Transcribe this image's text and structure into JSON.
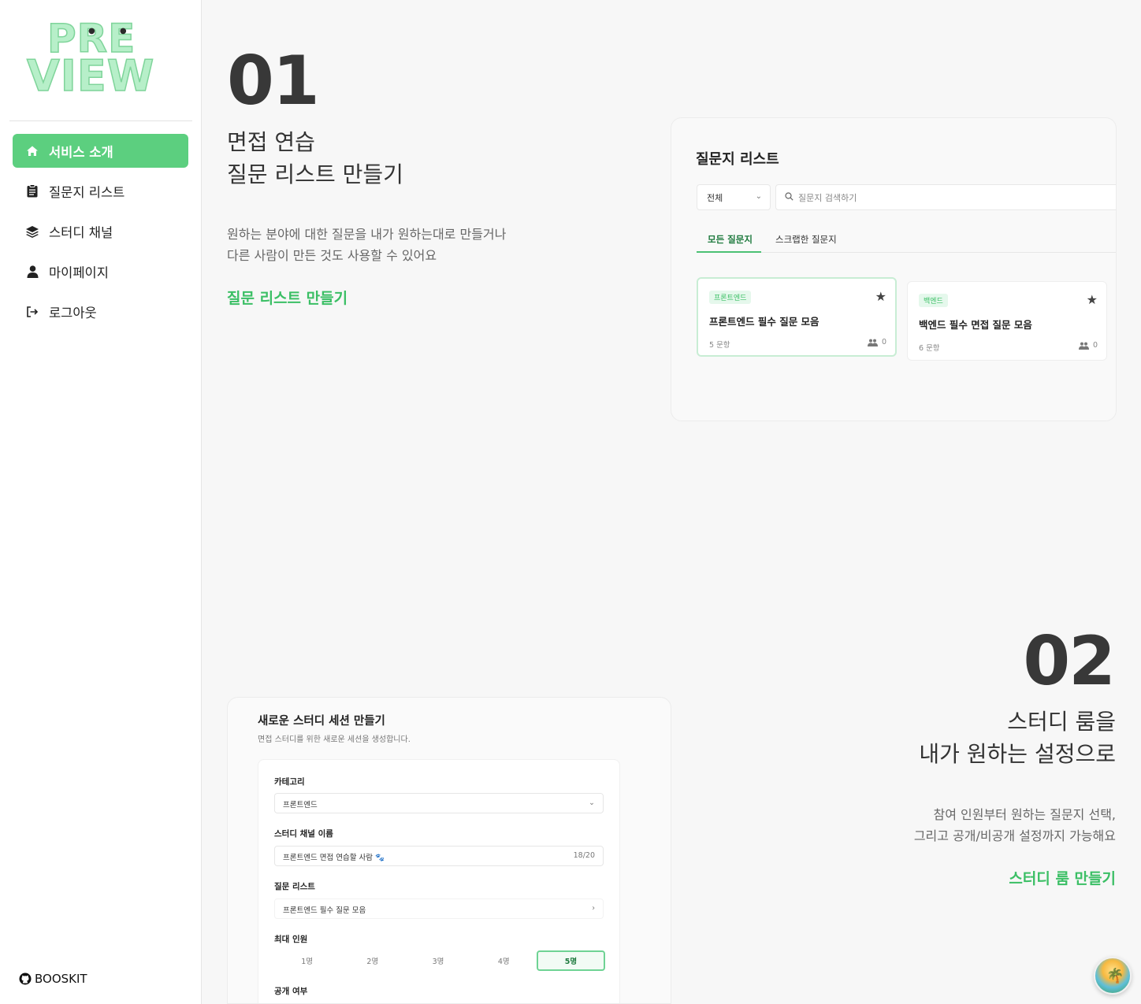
{
  "sidebar": {
    "logo": "PREVIEW",
    "items": [
      {
        "label": "서비스 소개",
        "icon": "home-icon",
        "active": true
      },
      {
        "label": "질문지 리스트",
        "icon": "clipboard-icon",
        "active": false
      },
      {
        "label": "스터디 채널",
        "icon": "layers-icon",
        "active": false
      },
      {
        "label": "마이페이지",
        "icon": "user-icon",
        "active": false
      },
      {
        "label": "로그아웃",
        "icon": "logout-icon",
        "active": false
      }
    ],
    "brand": "BOOSKIT",
    "accent": "#5ccf7f"
  },
  "section1": {
    "number": "01",
    "headline_line1": "면접 연습",
    "headline_line2": "질문 리스트 만들기",
    "desc_line1": "원하는 분야에 대한 질문을 내가 원하는대로 만들거나",
    "desc_line2": "다른 사람이 만든 것도 사용할 수 있어요",
    "cta": "질문 리스트 만들기"
  },
  "preview1": {
    "title": "질문지 리스트",
    "select_value": "전체",
    "search_placeholder": "질문지 검색하기",
    "tabs": [
      "모든 질문지",
      "스크랩한 질문지"
    ],
    "cards": [
      {
        "badge": "프론트엔드",
        "title": "프론트엔드 필수 질문 모음",
        "count": "5 문항",
        "users": "0"
      },
      {
        "badge": "백엔드",
        "title": "백엔드 필수 면접 질문 모음",
        "count": "6 문항",
        "users": "0"
      }
    ]
  },
  "section2": {
    "number": "02",
    "headline_line1": "스터디 룸을",
    "headline_line2": "내가 원하는 설정으로",
    "desc_line1": "참여 인원부터 원하는 질문지 선택,",
    "desc_line2": "그리고 공개/비공개 설정까지 가능해요",
    "cta": "스터디 룸 만들기"
  },
  "preview2": {
    "title": "새로운 스터디 세션 만들기",
    "subtitle": "면접 스터디를 위한 새로운 세션을 생성합니다.",
    "category_label": "카테고리",
    "category_value": "프론트엔드",
    "channel_label": "스터디 채널 이름",
    "channel_value": "프론트엔드 면접 연습할 사람 🐾",
    "channel_counter": "18/20",
    "list_label": "질문 리스트",
    "list_value": "프론트엔드 필수 질문 모음",
    "people_label": "최대 인원",
    "people_options": [
      "1명",
      "2명",
      "3명",
      "4명",
      "5명"
    ],
    "people_selected": "5명",
    "public_label": "공개 여부"
  }
}
